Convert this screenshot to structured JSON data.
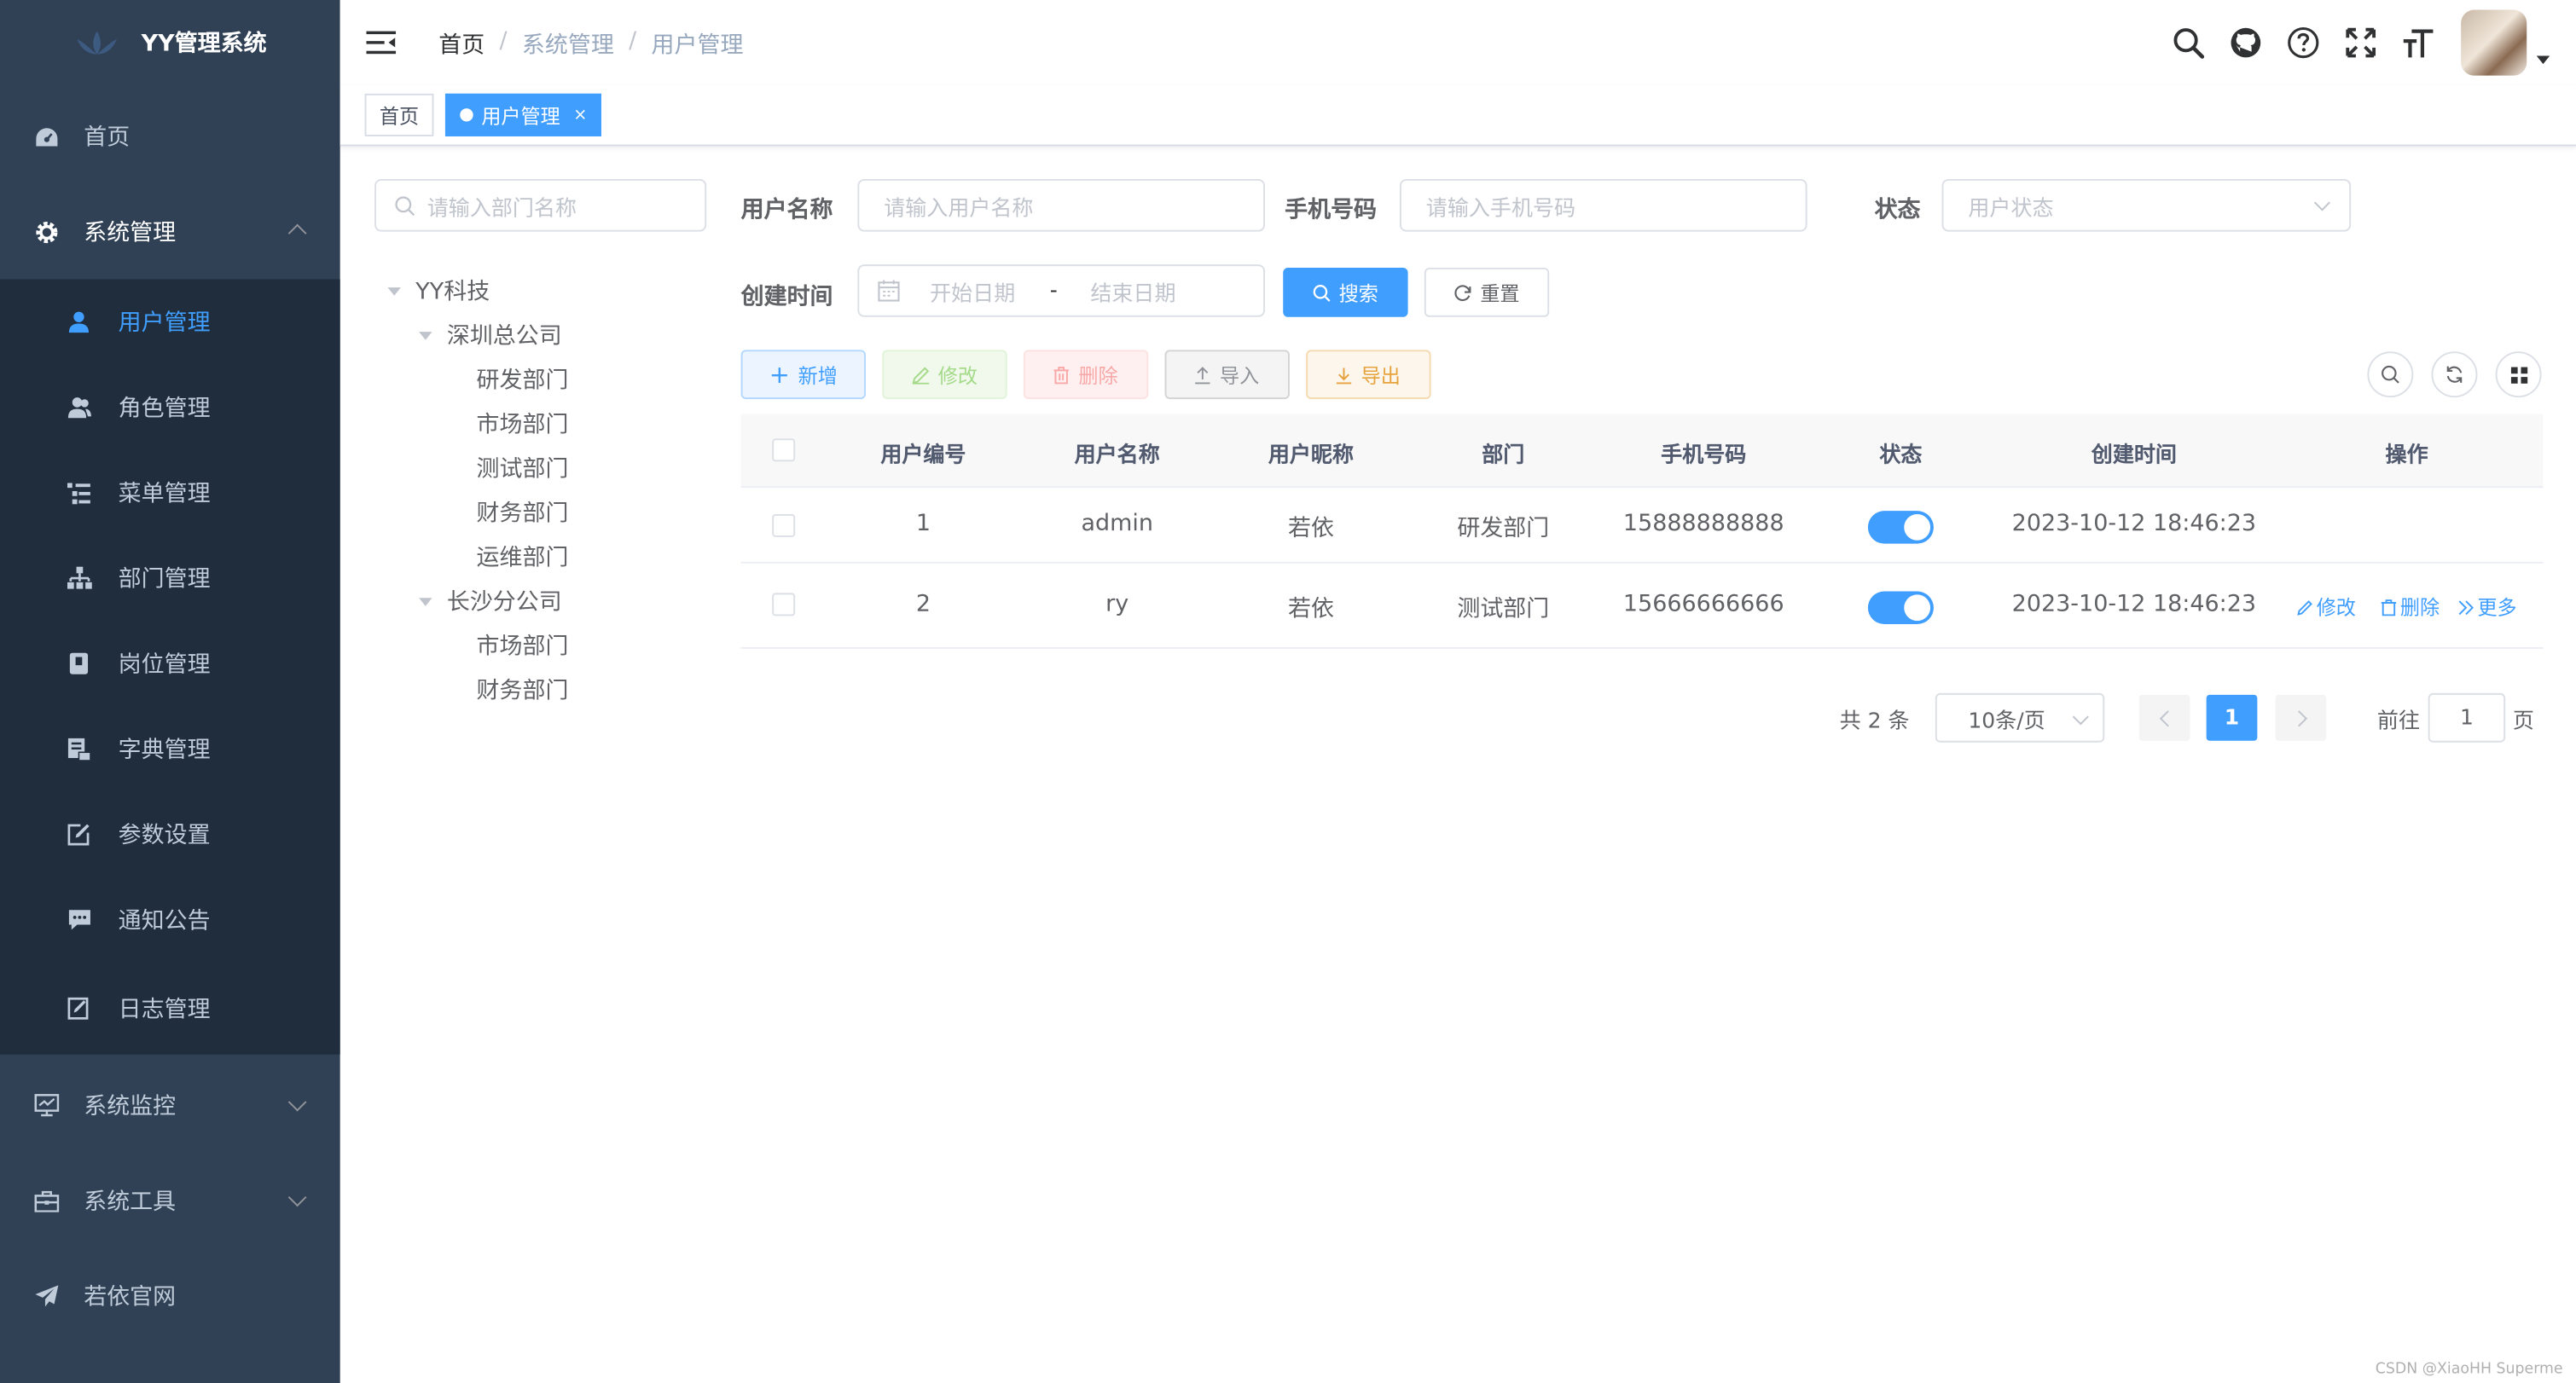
{
  "app": {
    "title": "YY管理系统"
  },
  "sidebar": {
    "items": [
      {
        "label": "首页",
        "icon": "dashboard-icon"
      },
      {
        "label": "系统管理",
        "icon": "gear-icon",
        "expanded": true,
        "children": [
          {
            "label": "用户管理",
            "icon": "user-icon",
            "active": true
          },
          {
            "label": "角色管理",
            "icon": "peoples-icon"
          },
          {
            "label": "菜单管理",
            "icon": "tree-table-icon"
          },
          {
            "label": "部门管理",
            "icon": "tree-icon"
          },
          {
            "label": "岗位管理",
            "icon": "post-icon"
          },
          {
            "label": "字典管理",
            "icon": "dict-icon"
          },
          {
            "label": "参数设置",
            "icon": "edit-icon"
          },
          {
            "label": "通知公告",
            "icon": "message-icon"
          },
          {
            "label": "日志管理",
            "icon": "log-icon"
          }
        ]
      },
      {
        "label": "系统监控",
        "icon": "monitor-icon"
      },
      {
        "label": "系统工具",
        "icon": "tool-icon"
      },
      {
        "label": "若依官网",
        "icon": "guide-icon"
      }
    ]
  },
  "header": {
    "breadcrumb": [
      "首页",
      "系统管理",
      "用户管理"
    ]
  },
  "tags": [
    {
      "label": "首页",
      "active": false
    },
    {
      "label": "用户管理",
      "active": true,
      "close": "×"
    }
  ],
  "dept_tree": {
    "search_placeholder": "请输入部门名称",
    "root": "YY科技",
    "branch1": "深圳总公司",
    "branch1_children": [
      "研发部门",
      "市场部门",
      "测试部门",
      "财务部门",
      "运维部门"
    ],
    "branch2": "长沙分公司",
    "branch2_children": [
      "市场部门",
      "财务部门"
    ]
  },
  "search_form": {
    "username_label": "用户名称",
    "username_placeholder": "请输入用户名称",
    "phone_label": "手机号码",
    "phone_placeholder": "请输入手机号码",
    "status_label": "状态",
    "status_placeholder": "用户状态",
    "time_label": "创建时间",
    "start_placeholder": "开始日期",
    "range_sep": "-",
    "end_placeholder": "结束日期",
    "search_btn": "搜索",
    "reset_btn": "重置"
  },
  "toolbar": {
    "add": "新增",
    "edit": "修改",
    "delete": "删除",
    "import": "导入",
    "export": "导出"
  },
  "table": {
    "columns": [
      "用户编号",
      "用户名称",
      "用户昵称",
      "部门",
      "手机号码",
      "状态",
      "创建时间",
      "操作"
    ],
    "rows": [
      {
        "id": "1",
        "username": "admin",
        "nickname": "若依",
        "dept": "研发部门",
        "phone": "15888888888",
        "status": true,
        "created": "2023-10-12 18:46:23"
      },
      {
        "id": "2",
        "username": "ry",
        "nickname": "若依",
        "dept": "测试部门",
        "phone": "15666666666",
        "status": true,
        "created": "2023-10-12 18:46:23"
      }
    ],
    "ops": {
      "edit": "修改",
      "delete": "删除",
      "more": "更多"
    }
  },
  "pagination": {
    "total": "共 2 条",
    "page_size": "10条/页",
    "current": "1",
    "goto_label": "前往",
    "goto_value": "1",
    "page_suffix": "页"
  },
  "colors": {
    "sidebar": "#304156",
    "submenu": "#1f2d3d",
    "primary": "#409eff"
  },
  "watermark": "CSDN @XiaoHH Superme"
}
